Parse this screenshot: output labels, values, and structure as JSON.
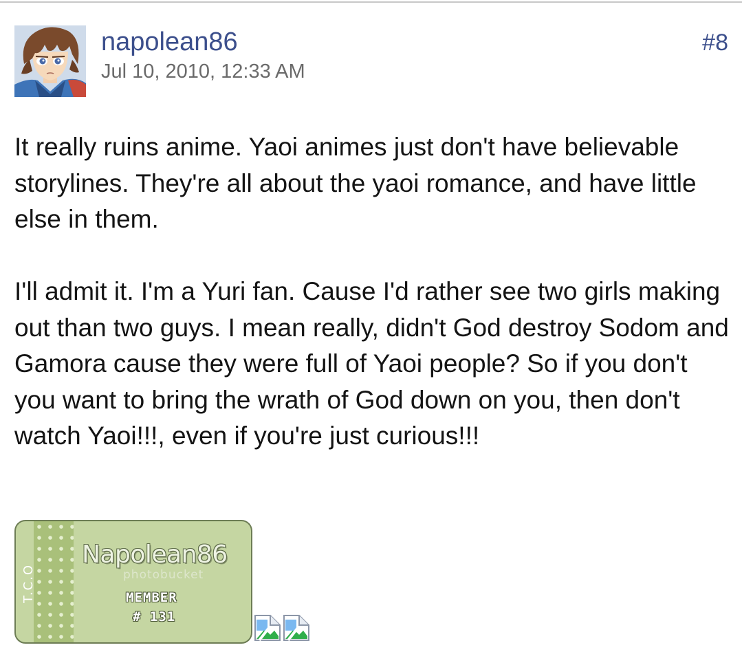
{
  "post": {
    "author": "napolean86",
    "timestamp": "Jul 10, 2010, 12:33 AM",
    "post_number": "#8",
    "paragraphs": [
      "It really ruins anime. Yaoi animes just don't have believable storylines. They're all about the yaoi romance, and have little else in them.",
      "I'll admit it. I'm a Yuri fan. Cause I'd rather see two girls making out than two guys. I mean really, didn't God destroy Sodom and Gamora cause they were full of Yaoi people? So if you don't you want to bring the wrath of God down on you, then don't watch Yaoi!!!, even if you're just curious!!!"
    ],
    "signature": {
      "side_text": "T.C.O",
      "name": "Napolean86",
      "watermark": "photobucket",
      "member_label": "MEMBER",
      "member_number": "# 131"
    }
  },
  "colors": {
    "link": "#3c4f8c",
    "meta": "#6a6a6a",
    "text": "#141414",
    "signature_green": "#c5d6a2"
  },
  "icons": {
    "broken_image_1": "broken-image-icon",
    "broken_image_2": "broken-image-icon"
  }
}
